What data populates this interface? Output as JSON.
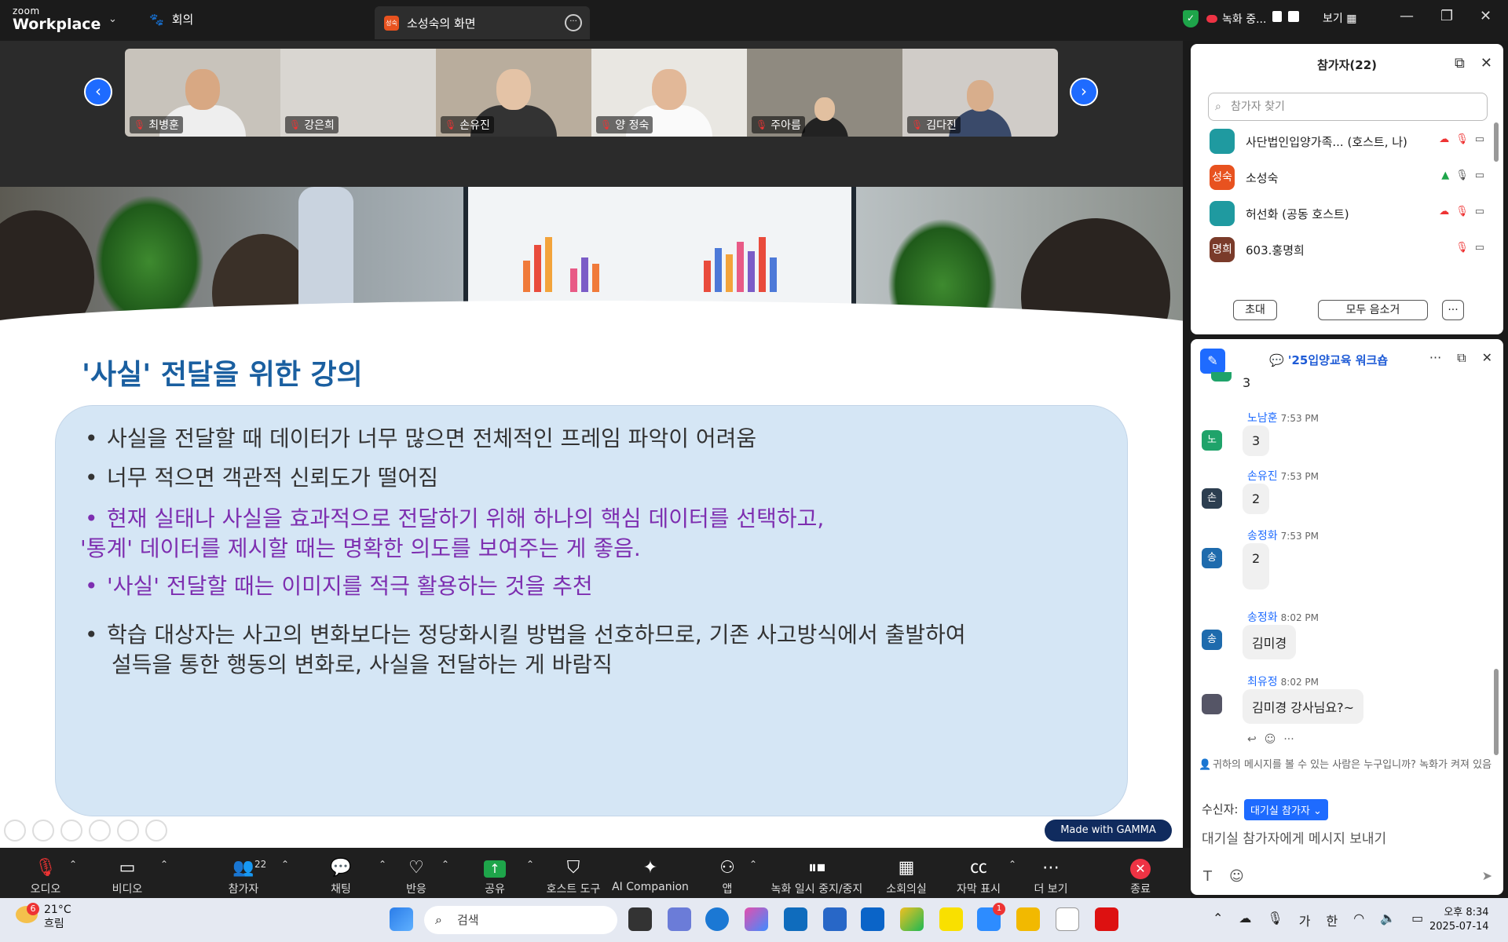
{
  "app": {
    "brand_top": "zoom",
    "brand_bottom": "Workplace",
    "meeting_tab": "회의",
    "share_tab": "소성숙의 화면",
    "share_avatar": "성숙"
  },
  "status": {
    "recording": "녹화 중...",
    "view": "보기"
  },
  "thumbnails": [
    {
      "name": "최병훈"
    },
    {
      "name": "강은희"
    },
    {
      "name": "손유진"
    },
    {
      "name": "양 정숙"
    },
    {
      "name": "주아름"
    },
    {
      "name": "김다진"
    }
  ],
  "slide": {
    "title": "'사실' 전달을 위한 강의",
    "bullets": [
      {
        "text": "사실을 전달할 때 데이터가 너무 많으면 전체적인 프레임 파악이 어려움"
      },
      {
        "text": "너무 적으면 객관적 신뢰도가 떨어짐"
      },
      {
        "line1": "현재 실태나 사실을 효과적으로 전달하기 위해 하나의 핵심 데이터를 선택하고,",
        "line2": "'통계' 데이터를 제시할 때는 명확한 의도를 보여주는 게 좋음."
      },
      {
        "text": "'사실' 전달할 때는 이미지를 적극 활용하는 것을 추천"
      },
      {
        "line1": "학습 대상자는 사고의 변화보다는 정당화시킬 방법을 선호하므로, 기존 사고방식에서 출발하여",
        "line2": "설득을 통한 행동의 변화로, 사실을 전달하는 게 바람직"
      }
    ],
    "badge": "Made with GAMMA"
  },
  "toolbar": {
    "audio": "오디오",
    "video": "비디오",
    "participants": "참가자",
    "participants_count": "22",
    "chat": "채팅",
    "reactions": "반응",
    "share": "공유",
    "host_tools": "호스트 도구",
    "ai": "AI Companion",
    "apps": "앱",
    "record": "녹화 일시 중지/중지",
    "breakout": "소회의실",
    "captions": "자막 표시",
    "more": "더 보기",
    "end": "종료"
  },
  "participants_panel": {
    "title": "참가자(22)",
    "search_placeholder": "참가자 찾기",
    "rows": [
      {
        "avatar": "",
        "name": "사단법인입양가족... (호스트, 나)",
        "color": "#1f9aa0"
      },
      {
        "avatar": "성숙",
        "name": "소성숙",
        "color": "#e8521f"
      },
      {
        "avatar": "",
        "name": "허선화 (공동 호스트)",
        "color": "#1f9aa0"
      },
      {
        "avatar": "명희",
        "name": "603.홍명희",
        "color": "#7a3b2a"
      }
    ],
    "invite": "초대",
    "mute_all": "모두 음소거"
  },
  "chat_panel": {
    "title": "'25입양교육 워크숍",
    "messages": [
      {
        "avatar": "노",
        "name": "노남훈",
        "time": "7:53 PM",
        "text": "3",
        "color": "#1fa36a"
      },
      {
        "avatar": "손",
        "name": "손유진",
        "time": "7:53 PM",
        "text": "2",
        "color": "#2c3e50"
      },
      {
        "avatar": "송",
        "name": "송정화",
        "time": "7:53 PM",
        "text": "2",
        "color": "#1e6bad"
      },
      {
        "avatar": "송",
        "name": "송정화",
        "time": "8:02 PM",
        "text": "김미경",
        "color": "#1e6bad"
      },
      {
        "avatar": "",
        "name": "최유정",
        "time": "8:02 PM",
        "text": "김미경 강사님요?~",
        "color": "#556"
      }
    ],
    "partial_text": "3",
    "note": "귀하의 메시지를 볼 수 있는 사람은 누구입니까? 녹화가 켜져 있음",
    "recipient_label": "수신자:",
    "recipient": "대기실 참가자",
    "input_placeholder": "대기실 참가자에게 메시지 보내기"
  },
  "taskbar": {
    "weather_temp": "21°C",
    "weather_desc": "흐림",
    "weather_badge": "6",
    "search": "검색",
    "ime1": "가",
    "ime2": "한",
    "time": "오후 8:34",
    "date": "2025-07-14",
    "zoom_badge": "1"
  }
}
